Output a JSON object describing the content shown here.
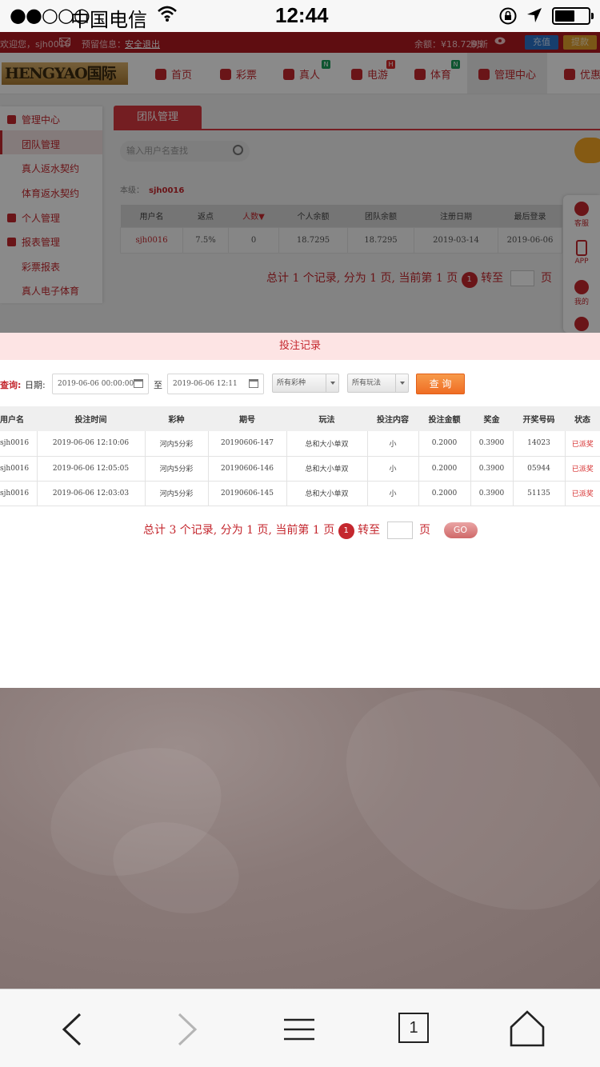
{
  "status_bar": {
    "signal": "●●○○○",
    "carrier": "中国电信",
    "time": "12:44"
  },
  "site": {
    "topbar": {
      "welcome": "欢迎您，sjh0016",
      "notice_label": "预留信息：",
      "logout": "安全退出",
      "balance": "余额：¥18.7295",
      "refresh": "刷新",
      "recharge": "充值",
      "withdraw": "提款"
    },
    "logo": "HENGYAO国际",
    "nav": [
      {
        "label": "首页"
      },
      {
        "label": "彩票"
      },
      {
        "label": "真人",
        "tag": "N"
      },
      {
        "label": "电游",
        "tag": "H"
      },
      {
        "label": "体育",
        "tag": "N"
      },
      {
        "label": "管理中心"
      },
      {
        "label": "优惠"
      }
    ],
    "sidebar": {
      "management": "管理中心",
      "team": "团队管理",
      "live_rebate": "真人返水契约",
      "sports_rebate": "体育返水契约",
      "personal": "个人管理",
      "reports": "报表管理",
      "lottery_report": "彩票报表",
      "live_report": "真人电子体育"
    },
    "content_tab": "团队管理",
    "search_placeholder": "输入用户名查找",
    "level_label": "本级：",
    "level_user": "sjh0016",
    "team_table": {
      "headers": [
        "用户名",
        "返点",
        "人数▼",
        "个人余额",
        "团队余额",
        "注册日期",
        "最后登录"
      ],
      "row": [
        "sjh0016",
        "7.5%",
        "0",
        "18.7295",
        "18.7295",
        "2019-03-14",
        "2019-06-06"
      ]
    },
    "team_pagination": {
      "text": "总计 1 个记录, 分为 1 页, 当前第 1 页",
      "current": "1",
      "goto": "转至",
      "page": "页"
    },
    "float": {
      "service": "客服",
      "app": "APP",
      "mine": "我的"
    }
  },
  "dialog": {
    "title": "投注记录",
    "query_label": "查询:",
    "date_label": "日期:",
    "date_from": "2019-06-06 00:00:00",
    "to": "至",
    "date_to": "2019-06-06 12:11",
    "lottery_select": "所有彩种",
    "play_select": "所有玩法",
    "query_button": "查 询",
    "headers": [
      "用户名",
      "投注时间",
      "彩种",
      "期号",
      "玩法",
      "投注内容",
      "投注金额",
      "奖金",
      "开奖号码",
      "状态"
    ],
    "rows": [
      [
        "sjh0016",
        "2019-06-06 12:10:06",
        "河内5分彩",
        "20190606-147",
        "总和大小单双",
        "小",
        "0.2000",
        "0.3900",
        "14023",
        "已派奖"
      ],
      [
        "sjh0016",
        "2019-06-06 12:05:05",
        "河内5分彩",
        "20190606-146",
        "总和大小单双",
        "小",
        "0.2000",
        "0.3900",
        "05944",
        "已派奖"
      ],
      [
        "sjh0016",
        "2019-06-06 12:03:03",
        "河内5分彩",
        "20190606-145",
        "总和大小单双",
        "小",
        "0.2000",
        "0.3900",
        "51135",
        "已派奖"
      ]
    ],
    "pagination": {
      "text": "总计 3 个记录, 分为 1 页, 当前第 1 页",
      "current": "1",
      "goto": "转至",
      "page": "页",
      "go": "GO"
    }
  },
  "toolbar": {
    "tabs_count": "1"
  },
  "colors": {
    "brand_red": "#c4272e",
    "query_orange": "#ef6d24",
    "dialog_title_bg": "#fde4e4"
  }
}
